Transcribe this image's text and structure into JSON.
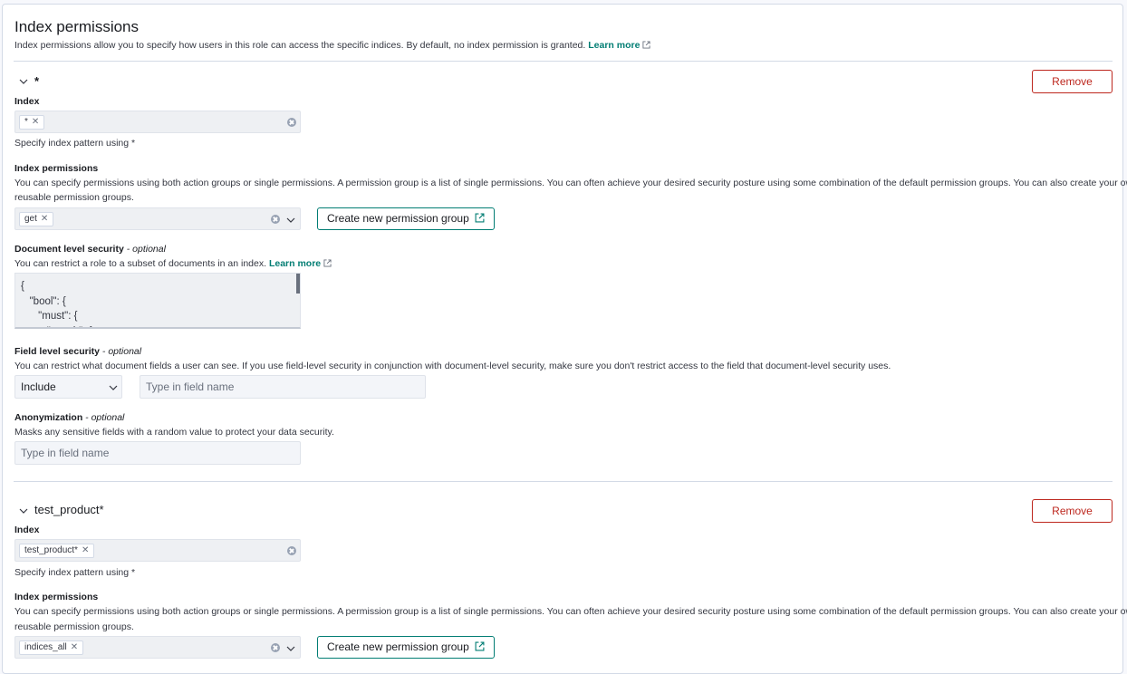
{
  "header": {
    "title": "Index permissions",
    "description": "Index permissions allow you to specify how users in this role can access the specific indices. By default, no index permission is granted.",
    "learn_more": "Learn more"
  },
  "sections": [
    {
      "name": "*",
      "remove_label": "Remove",
      "index_label": "Index",
      "index_chips": [
        "*"
      ],
      "index_help": "Specify index pattern using *",
      "perm_label": "Index permissions",
      "perm_desc_line1": "You can specify permissions using both action groups or single permissions. A permission group is a list of single permissions. You can often achieve your desired security posture using some combination of the default permission groups. You can also create your own",
      "perm_desc_line2": "reusable permission groups.",
      "perm_chips": [
        "get"
      ],
      "create_group_label": "Create new permission group",
      "dls_label": "Document level security",
      "optional": "optional",
      "dls_desc": "You can restrict a role to a subset of documents in an index.",
      "dls_learn_more": "Learn more",
      "dls_code": "{\n   \"bool\": {\n      \"must\": {\n         \"match\": {",
      "fls_label": "Field level security",
      "fls_desc": "You can restrict what document fields a user can see. If you use field-level security in conjunction with document-level security, make sure you don't restrict access to the field that document-level security uses.",
      "fls_mode": "Include",
      "fls_placeholder": "Type in field name",
      "anon_label": "Anonymization",
      "anon_desc": "Masks any sensitive fields with a random value to protect your data security.",
      "anon_placeholder": "Type in field name"
    },
    {
      "name": "test_product*",
      "remove_label": "Remove",
      "index_label": "Index",
      "index_chips": [
        "test_product*"
      ],
      "index_help": "Specify index pattern using *",
      "perm_label": "Index permissions",
      "perm_desc_line1": "You can specify permissions using both action groups or single permissions. A permission group is a list of single permissions. You can often achieve your desired security posture using some combination of the default permission groups. You can also create your own",
      "perm_desc_line2": "reusable permission groups.",
      "perm_chips": [
        "indices_all"
      ],
      "create_group_label": "Create new permission group"
    }
  ],
  "colors": {
    "remove": "#bd271e",
    "accent_green": "#017d73",
    "link_blue": "#006bb8"
  }
}
